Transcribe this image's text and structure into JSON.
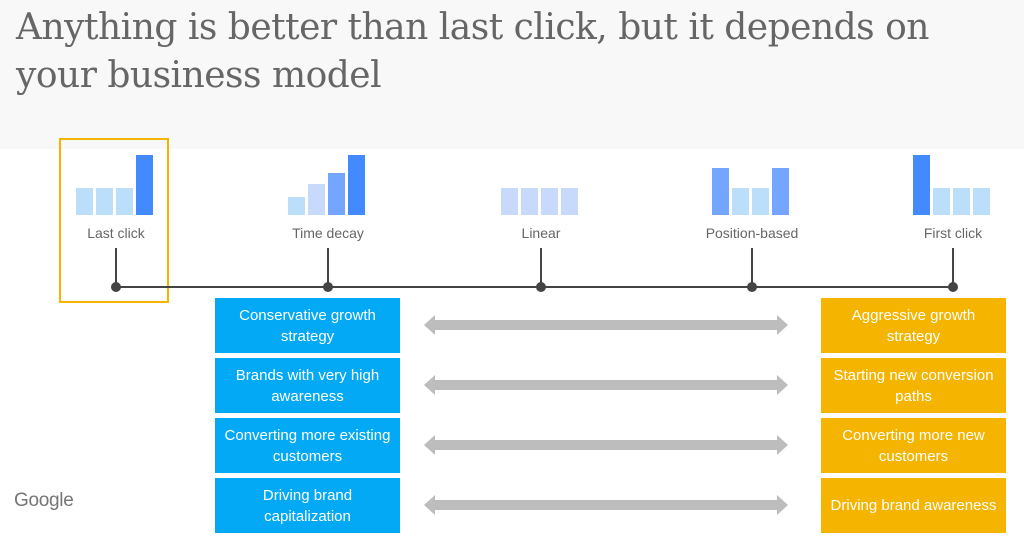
{
  "title": "Anything is better than last click, but it depends on your business model",
  "colors": {
    "dark_blue": "#448aff",
    "mid_blue": "#74a6ff",
    "light_blue": "#bbdefb",
    "pale_blue": "#c8dafc",
    "left_box": "#03a9f4",
    "right_box": "#f4b400",
    "highlight": "#f4b400",
    "arrow": "#bdbdbd",
    "axis": "#444444"
  },
  "models": [
    {
      "label": "Last click",
      "weights": [
        0.45,
        0.45,
        0.45,
        1.0
      ],
      "shades": [
        "light_blue",
        "light_blue",
        "light_blue",
        "dark_blue"
      ],
      "highlighted": true
    },
    {
      "label": "Time decay",
      "weights": [
        0.3,
        0.52,
        0.7,
        1.0
      ],
      "shades": [
        "light_blue",
        "pale_blue",
        "mid_blue",
        "dark_blue"
      ],
      "highlighted": false
    },
    {
      "label": "Linear",
      "weights": [
        0.45,
        0.45,
        0.45,
        0.45
      ],
      "shades": [
        "pale_blue",
        "pale_blue",
        "pale_blue",
        "pale_blue"
      ],
      "highlighted": false
    },
    {
      "label": "Position-based",
      "weights": [
        0.78,
        0.45,
        0.45,
        0.78
      ],
      "shades": [
        "mid_blue",
        "light_blue",
        "light_blue",
        "mid_blue"
      ],
      "highlighted": false
    },
    {
      "label": "First click",
      "weights": [
        1.0,
        0.45,
        0.45,
        0.45
      ],
      "shades": [
        "dark_blue",
        "light_blue",
        "light_blue",
        "light_blue"
      ],
      "highlighted": false
    }
  ],
  "comparisons": [
    {
      "left": "Conservative growth strategy",
      "right": "Aggressive growth strategy"
    },
    {
      "left": "Brands with very high awareness",
      "right": "Starting new conversion paths"
    },
    {
      "left": "Converting more existing customers",
      "right": "Converting more new customers"
    },
    {
      "left": "Driving brand capitalization",
      "right": "Driving brand awareness"
    }
  ],
  "footer": {
    "logo": "Google"
  }
}
